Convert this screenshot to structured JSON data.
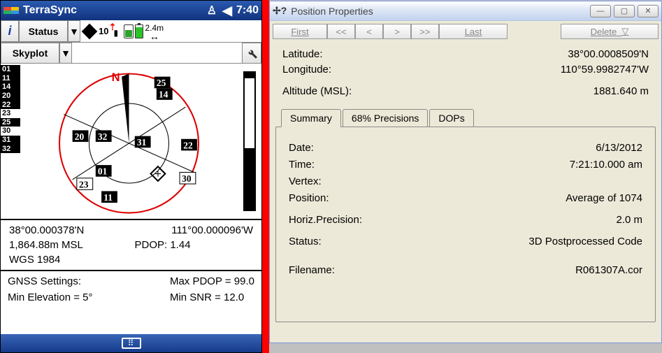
{
  "wm": {
    "title": "TerraSync",
    "time": "7:40"
  },
  "toolbar1": {
    "info": "i",
    "status_label": "Status",
    "dropdown_glyph": "▼",
    "sat_count": "10",
    "distance": "2.4m",
    "distance_arrows": "↔"
  },
  "toolbar2": {
    "skyplot_label": "Skyplot",
    "dropdown_glyph": "▼"
  },
  "sat_list": [
    {
      "id": "01",
      "style": "blk"
    },
    {
      "id": "11",
      "style": "blk"
    },
    {
      "id": "14",
      "style": "blk"
    },
    {
      "id": "20",
      "style": "blk"
    },
    {
      "id": "22",
      "style": "blk"
    },
    {
      "id": "23",
      "style": "wht"
    },
    {
      "id": "25",
      "style": "blk"
    },
    {
      "id": "30",
      "style": "wht"
    },
    {
      "id": "31",
      "style": "blk"
    },
    {
      "id": "32",
      "style": "blk"
    }
  ],
  "plot_labels": {
    "N": "N",
    "p25": "25",
    "p14": "14",
    "p20": "20",
    "p32": "32",
    "p31": "31",
    "p22": "22",
    "p01": "01",
    "p23": "23",
    "p11": "11",
    "p30": "30"
  },
  "coords": {
    "lat": "38°00.000378'N",
    "lon": "111°00.000096'W",
    "alt": "1,864.88m MSL",
    "pdop": "PDOP: 1.44",
    "datum": "WGS 1984"
  },
  "gnss": {
    "settings_label": "GNSS Settings:",
    "max_pdop": "Max PDOP = 99.0",
    "min_elev": "Min Elevation = 5°",
    "min_snr": "Min SNR = 12.0"
  },
  "dlg": {
    "title": "Position Properties",
    "nav": {
      "first": "First",
      "prev2": "<<",
      "prev": "<",
      "next": ">",
      "next2": ">>",
      "last": "Last",
      "delete": "Delete",
      "del_glyph": "▽"
    },
    "props": {
      "lat_label": "Latitude:",
      "lat_val": "38°00.0008509'N",
      "lon_label": "Longitude:",
      "lon_val": "110°59.9982747'W",
      "alt_label": "Altitude (MSL):",
      "alt_val": "1881.640 m"
    },
    "tabs": {
      "summary": "Summary",
      "precisions": "68% Precisions",
      "dops": "DOPs"
    },
    "summary": {
      "date_label": "Date:",
      "date_val": "6/13/2012",
      "time_label": "Time:",
      "time_val": "7:21:10.000 am",
      "vertex_label": "Vertex:",
      "vertex_val": "",
      "position_label": "Position:",
      "position_val": "Average of 1074",
      "hprec_label": "Horiz.Precision:",
      "hprec_val": "2.0 m",
      "status_label": "Status:",
      "status_val": "3D Postprocessed Code",
      "filename_label": "Filename:",
      "filename_val": "R061307A.cor"
    }
  }
}
